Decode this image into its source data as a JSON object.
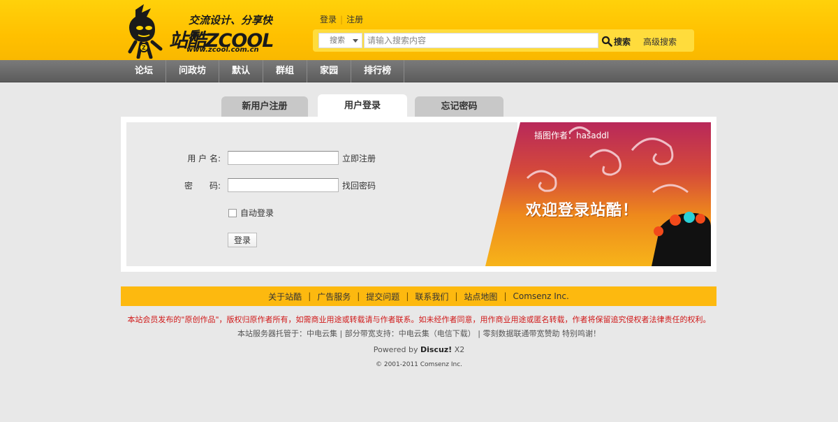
{
  "header": {
    "logo": {
      "slogan": "交流设计、分享快乐",
      "brand": "站酷ZCOOL",
      "url_text": "www.zcool.com.cn"
    },
    "top_links": {
      "login": "登录",
      "register": "注册"
    },
    "search": {
      "scope": "搜索",
      "placeholder": "请输入搜索内容",
      "button": "搜索",
      "advanced": "高级搜索"
    }
  },
  "nav": {
    "items": [
      "论坛",
      "问政坊",
      "默认",
      "群组",
      "家园",
      "排行榜"
    ]
  },
  "tabs": {
    "register": "新用户注册",
    "login": "用户登录",
    "forgot": "忘记密码"
  },
  "form": {
    "username_label": "用 户 名:",
    "username_value": "",
    "register_link": "立即注册",
    "password_label": "密　　码:",
    "password_value": "",
    "recover_link": "找回密码",
    "auto_login": "自动登录",
    "submit": "登录"
  },
  "banner": {
    "credit": "插图作者：hasaddl",
    "title": "欢迎登录站酷！"
  },
  "footer": {
    "links": [
      "关于站酷",
      "广告服务",
      "提交问题",
      "联系我们",
      "站点地图",
      "Comsenz Inc."
    ],
    "copyright_notice": "本站会员发布的\"原创作品\"，版权归原作者所有，如需商业用途或转载请与作者联系。如未经作者同意，用作商业用途或匿名转载，作者将保留追究侵权者法律责任的权利。",
    "hosting": "本站服务器托管于：中电云集 | 部分带宽支持：中电云集（电信下载） | 零刻数据联通带宽赞助 特别鸣谢！",
    "powered_prefix": "Powered by",
    "powered_brand": "Discuz!",
    "powered_version": "X2",
    "copyright": "© 2001-2011 Comsenz Inc."
  },
  "colors": {
    "header_yellow": "#ffc000",
    "nav_gray": "#666666",
    "footer_bar": "#fdb90f",
    "notice_red": "#d01818"
  }
}
